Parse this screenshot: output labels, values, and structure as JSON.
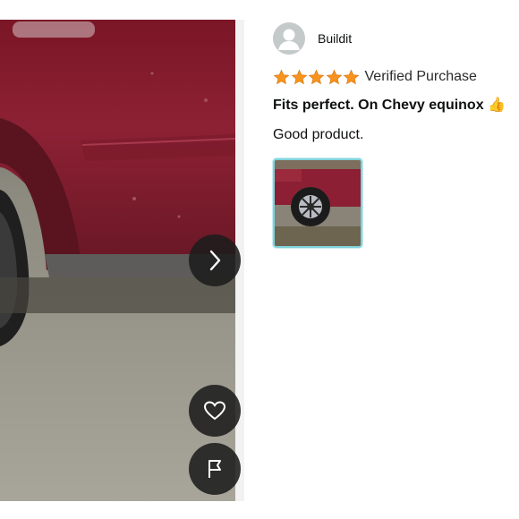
{
  "viewer": {
    "photo_icon": "car-side-photo",
    "next_icon": "chevron-right-icon",
    "like_icon": "heart-icon",
    "report_icon": "flag-icon"
  },
  "review": {
    "reviewer_name": "Buildit",
    "avatar_icon": "default-user-avatar",
    "rating": 5,
    "rating_max": 5,
    "verified_label": "Verified Purchase",
    "title": "Fits perfect. On Chevy equinox 👍",
    "body": "Good product.",
    "thumbnail_icon": "car-wheel-thumbnail"
  },
  "colors": {
    "star": "#f7931e",
    "thumb_border": "#7fd3dc",
    "button_bg": "#1c1c1c"
  }
}
